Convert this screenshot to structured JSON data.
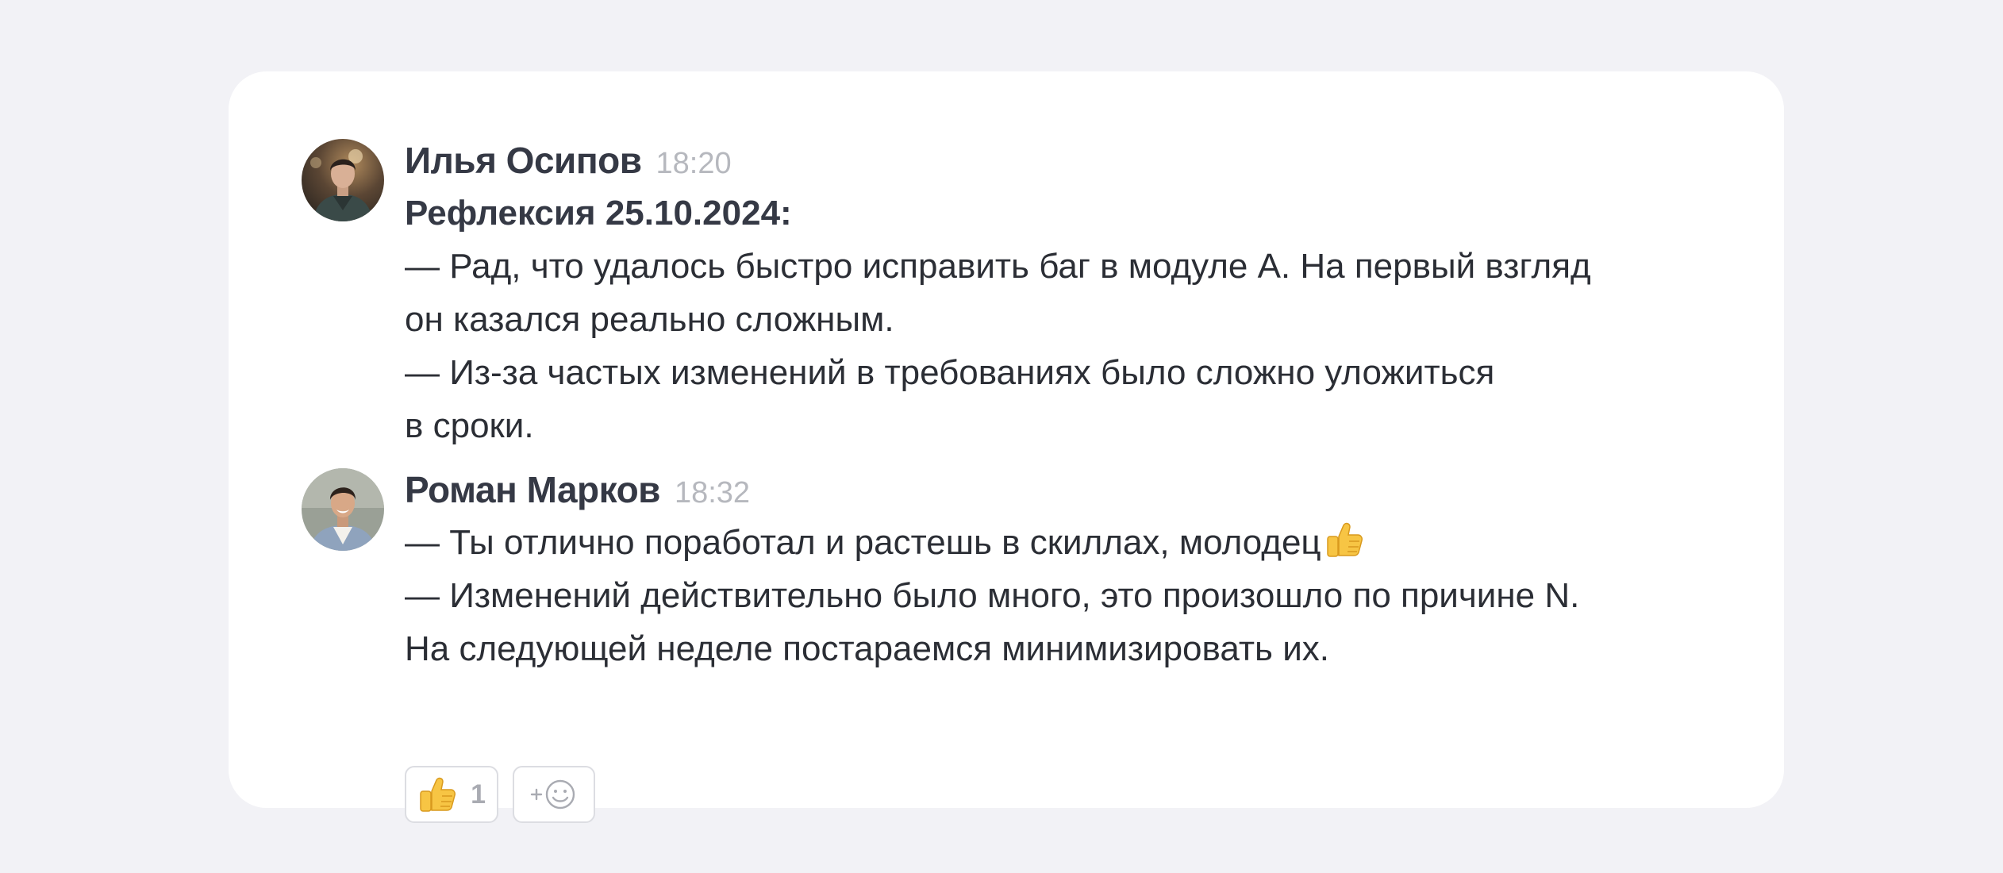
{
  "messages": [
    {
      "author": "Илья Осипов",
      "time": "18:20",
      "avatar": "avatar-photo-man-dark-jacket",
      "heading": "Рефлексия 25.10.2024:",
      "lines": [
        "— Рад, что удалось быстро исправить баг в модуле А. На первый взгляд",
        "он казался реально сложным.",
        "— Из-за частых изменений в требованиях было сложно уложиться",
        "в сроки."
      ]
    },
    {
      "author": "Роман Марков",
      "time": "18:32",
      "avatar": "avatar-photo-man-denim-shirt",
      "lines": [
        "— Ты отлично поработал и растешь в скиллах, молодец",
        "— Изменений действительно было много, это произошло по причине N.",
        "На следующей неделе постараемся минимизировать их."
      ],
      "inline_emoji": "thumbs-up-icon",
      "reactions": [
        {
          "emoji": "thumbs-up-icon",
          "count": "1"
        }
      ],
      "add_reaction": {
        "label": "+",
        "icon": "smiley-icon"
      }
    }
  ],
  "colors": {
    "background": "#f2f2f6",
    "card": "#ffffff",
    "text": "#2b2e35",
    "timestamp": "#b6b8be",
    "chip_border": "#dcdde2"
  }
}
